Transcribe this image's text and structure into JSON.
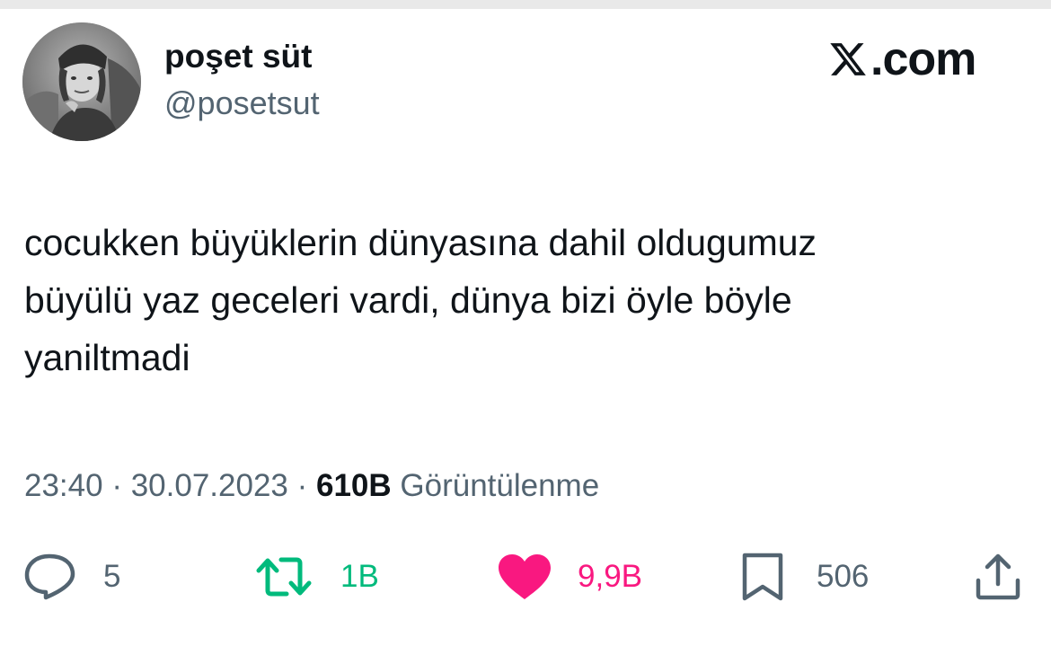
{
  "site": {
    "logo_icon": "x-logo-icon",
    "logo_text": ".com"
  },
  "author": {
    "display_name": "poşet süt",
    "handle": "@posetsut",
    "avatar_icon": "grayscale-portrait-avatar"
  },
  "tweet": {
    "lines": [
      "cocukken büyüklerin dünyasına dahil oldugumuz",
      "büyülü yaz geceleri vardi, dünya bizi öyle böyle",
      "yaniltmadi"
    ]
  },
  "meta": {
    "time": "23:40",
    "separator": " · ",
    "date": "30.07.2023",
    "views_count": "610B",
    "views_label": "Görüntülenme"
  },
  "actions": {
    "reply": {
      "icon": "reply-bubble-icon",
      "count": "5"
    },
    "retweet": {
      "icon": "retweet-icon",
      "count": "1B"
    },
    "like": {
      "icon": "heart-icon",
      "count": "9,9B"
    },
    "bookmark": {
      "icon": "bookmark-icon",
      "count": "506"
    },
    "share": {
      "icon": "share-icon"
    }
  },
  "colors": {
    "text": "#0f1419",
    "secondary": "#536471",
    "retweet": "#00ba7c",
    "like": "#f91880"
  }
}
